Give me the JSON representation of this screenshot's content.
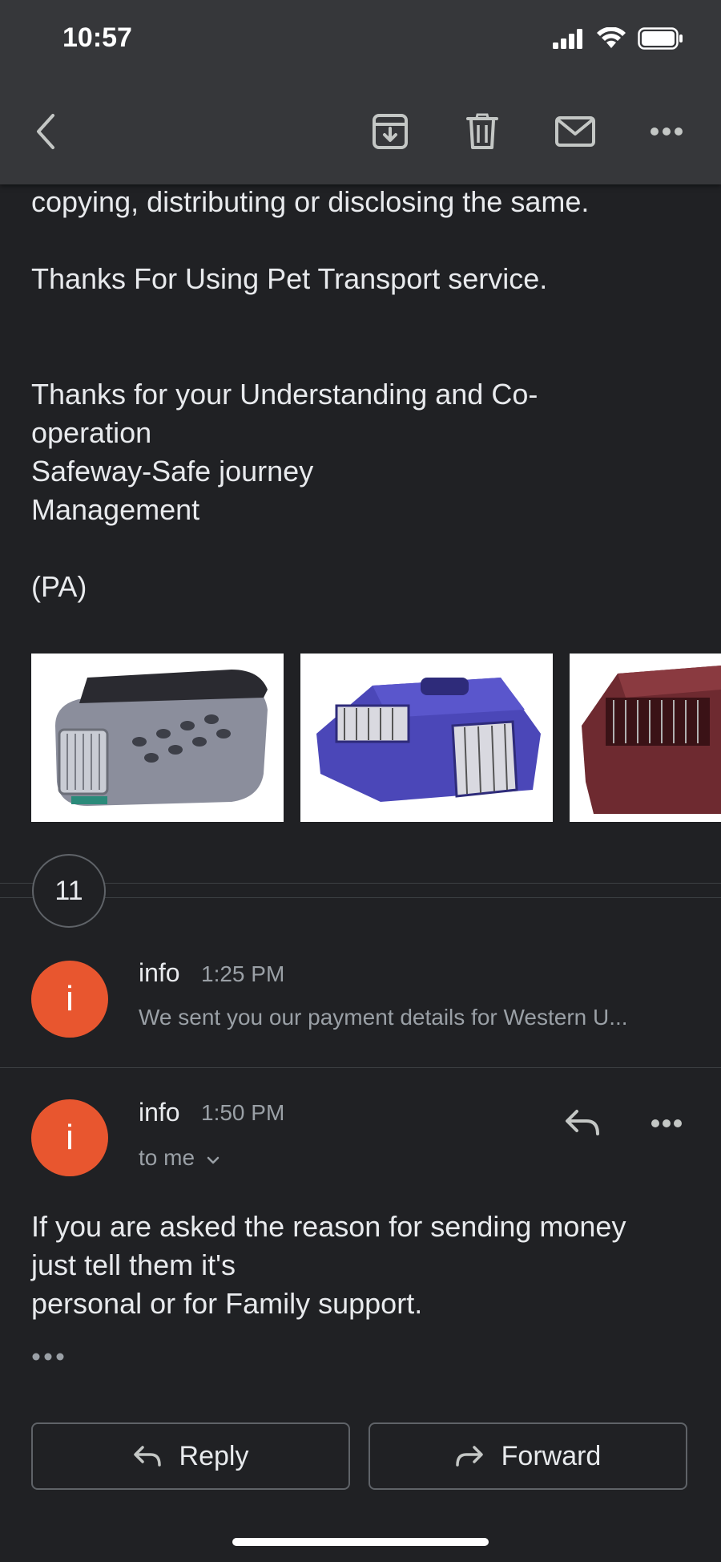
{
  "status_bar": {
    "time": "10:57"
  },
  "email_body": {
    "line_copying": "copying, distributing or disclosing the same.",
    "thanks_service": "Thanks For Using Pet Transport service.",
    "understanding_line1": "Thanks for your Understanding and Co-",
    "understanding_line2": "operation",
    "company": "Safeway-Safe journey",
    "management": "Management",
    "initials": "(PA)"
  },
  "attachments": [
    {
      "icon": "pet-carrier-gray-image"
    },
    {
      "icon": "pet-carrier-blue-image"
    },
    {
      "icon": "pet-carrier-red-image"
    }
  ],
  "collapsed_count": "11",
  "message_collapsed": {
    "avatar_letter": "i",
    "sender": "info",
    "time": "1:25 PM",
    "snippet": "We sent you our payment details for Western U..."
  },
  "message_expanded": {
    "avatar_letter": "i",
    "sender": "info",
    "time": "1:50 PM",
    "recipient": "to me",
    "body_line1": "If you are asked the reason for sending money",
    "body_line2": "just tell them it's",
    "body_line3": "personal or for Family support."
  },
  "buttons": {
    "reply": "Reply",
    "forward": "Forward"
  },
  "colors": {
    "background": "#202124",
    "avatar": "#e8562f",
    "toolbar": "#38393c"
  }
}
